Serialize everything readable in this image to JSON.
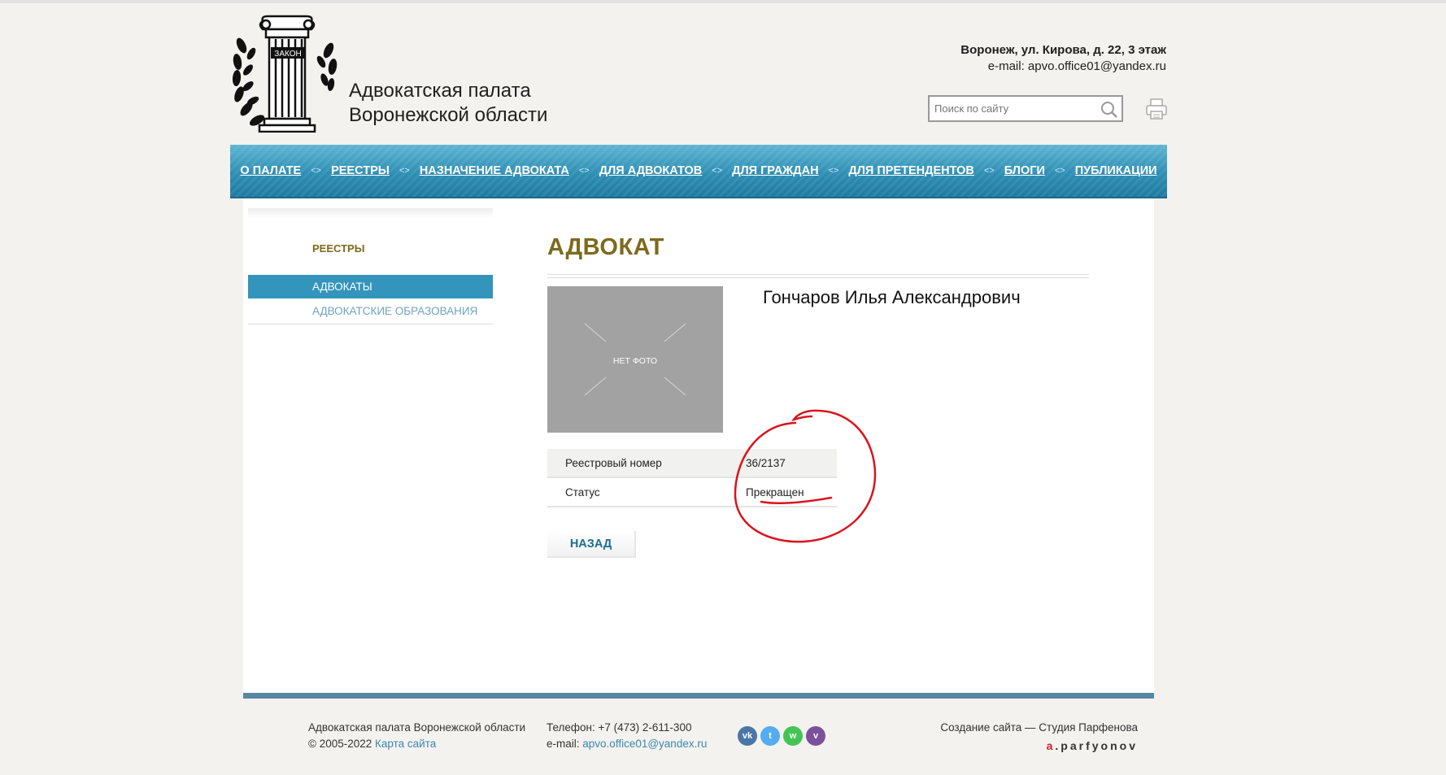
{
  "header": {
    "logo_text": "ЗАКОН",
    "site_name_line1": "Адвокатская палата",
    "site_name_line2": "Воронежской области",
    "address": "Воронеж, ул. Кирова, д. 22, 3 этаж",
    "email_line": "e-mail: apvo.office01@yandex.ru",
    "search_placeholder": "Поиск по сайту"
  },
  "nav": {
    "items": [
      {
        "label": "О ПАЛАТЕ"
      },
      {
        "label": "РЕЕСТРЫ"
      },
      {
        "label": "НАЗНАЧЕНИЕ АДВОКАТА"
      },
      {
        "label": "ДЛЯ АДВОКАТОВ"
      },
      {
        "label": "ДЛЯ ГРАЖДАН"
      },
      {
        "label": "ДЛЯ ПРЕТЕНДЕНТОВ"
      },
      {
        "label": "БЛОГИ"
      },
      {
        "label": "ПУБЛИКАЦИИ"
      }
    ],
    "separator": "<>"
  },
  "sidebar": {
    "title": "РЕЕСТРЫ",
    "items": [
      {
        "label": "АДВОКАТЫ"
      },
      {
        "label": "АДВОКАТСКИЕ ОБРАЗОВАНИЯ"
      }
    ]
  },
  "main": {
    "title": "АДВОКАТ",
    "photo_label": "НЕТ ФОТО",
    "name": "Гончаров Илья Александрович",
    "fields": [
      {
        "label": "Реестровый номер",
        "value": "36/2137"
      },
      {
        "label": "Статус",
        "value": "Прекращен"
      }
    ],
    "back_label": "НАЗАД"
  },
  "footer": {
    "org_name": "Адвокатская палата Воронежской области",
    "copyright": "© 2005-2022",
    "sitemap_label": "Карта сайта",
    "phone": "Телефон: +7 (473) 2-611-300",
    "email_prefix": "e-mail:",
    "email": "apvo.office01@yandex.ru",
    "social": [
      {
        "name": "vk",
        "glyph": "vk",
        "color": "#4a76a8"
      },
      {
        "name": "twitter",
        "glyph": "t",
        "color": "#55acee"
      },
      {
        "name": "whatsapp",
        "glyph": "w",
        "color": "#43c553"
      },
      {
        "name": "viber",
        "glyph": "v",
        "color": "#7b519d"
      }
    ],
    "credit": "Создание сайта — Студия Парфенова",
    "brand_a": "a",
    "brand_rest": ".parfyonov"
  },
  "colors": {
    "nav_blue": "#2e8eb4",
    "title_gold": "#7d6a1c",
    "link_blue": "#3d86b0",
    "annotation_red": "#d8141d"
  }
}
